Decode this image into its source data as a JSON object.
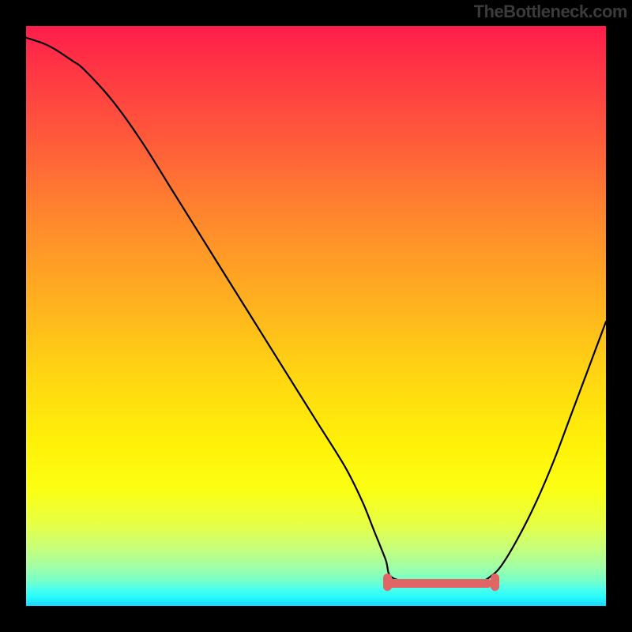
{
  "watermark": "TheBottleneck.com",
  "chart_data": {
    "type": "line",
    "title": "",
    "xlabel": "",
    "ylabel": "",
    "xlim": [
      0,
      100
    ],
    "ylim": [
      0,
      100
    ],
    "series": [
      {
        "name": "bottleneck-curve",
        "x": [
          0,
          3,
          5,
          8,
          10,
          15,
          20,
          25,
          30,
          35,
          40,
          45,
          50,
          55,
          58,
          60,
          62,
          63,
          67,
          71,
          75,
          78,
          80,
          82,
          85,
          88,
          91,
          94,
          97,
          100
        ],
        "values": [
          98,
          97,
          96,
          94,
          92.5,
          87,
          80,
          72,
          64,
          56,
          48,
          40,
          32,
          24,
          18,
          13,
          8,
          5,
          4,
          4,
          4,
          4,
          5,
          7,
          12,
          18,
          25,
          33,
          41,
          49
        ]
      }
    ],
    "annotations": [
      {
        "type": "highlight-range",
        "name": "optimal-range",
        "x_start": 62,
        "x_end": 80,
        "y": 4
      }
    ],
    "background": {
      "type": "vertical-gradient",
      "stops": [
        {
          "pos": 0,
          "color": "#ff1d4b"
        },
        {
          "pos": 0.2,
          "color": "#ff5c3a"
        },
        {
          "pos": 0.48,
          "color": "#ffd512"
        },
        {
          "pos": 0.8,
          "color": "#fbff13"
        },
        {
          "pos": 0.93,
          "color": "#a4ffa2"
        },
        {
          "pos": 1.0,
          "color": "#18d6ff"
        }
      ]
    }
  },
  "colors": {
    "highlight": "#e06666",
    "curve": "#000000"
  }
}
